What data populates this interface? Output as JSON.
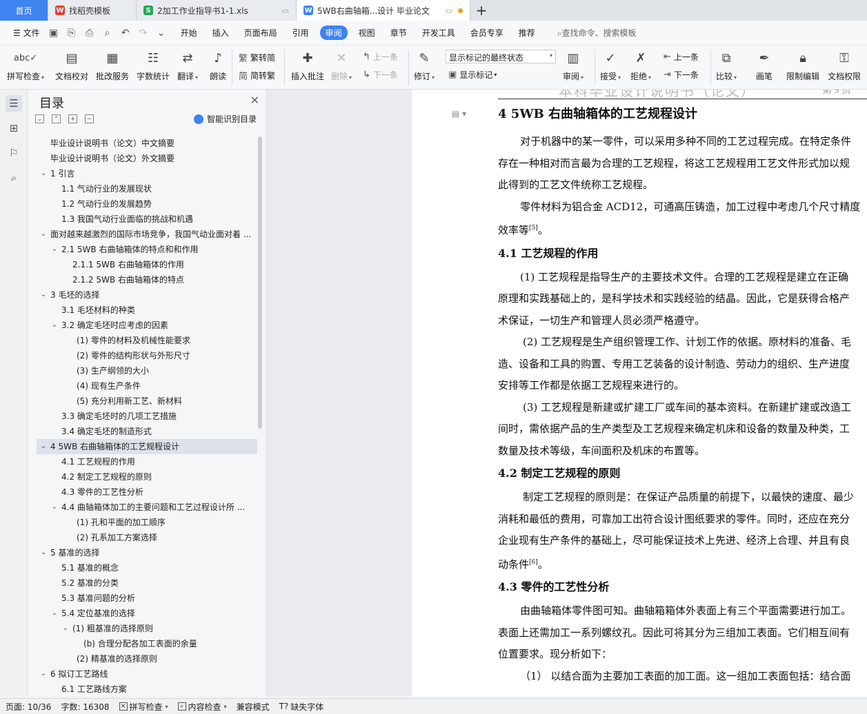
{
  "tabs": [
    {
      "label": "首页",
      "kind": "home"
    },
    {
      "label": "找稻壳模板",
      "kind": "docer",
      "color": "#e0403a",
      "icon": "docer-icon"
    },
    {
      "label": "2加工作业指导书1-1.xls",
      "kind": "xls",
      "color": "#2aa35a",
      "icon": "spreadsheet-icon"
    },
    {
      "label": "5WB右曲轴箱...设计 毕业论文",
      "kind": "doc",
      "color": "#3f83f1",
      "icon": "document-icon"
    }
  ],
  "menu": {
    "file": "文件",
    "items": [
      "开始",
      "插入",
      "页面布局",
      "引用",
      "审阅",
      "视图",
      "章节",
      "开发工具",
      "会员专享",
      "推荐"
    ],
    "active": "审阅",
    "search": "查找命令、搜索模板"
  },
  "ribbon": {
    "spellcheck": "拼写检查",
    "doc_proof": "文档校对",
    "batch_service": "批改服务",
    "word_count": "字数统计",
    "translate": "翻译",
    "read_aloud": "朗读",
    "trad_to_simp": "繁转简",
    "simp_to_trad": "简转繁",
    "insert_comment": "插入批注",
    "delete": "删除",
    "prev_comment": "上一条",
    "next_comment": "下一条",
    "revise": "修订",
    "markup_mode": "显示标记的最终状态",
    "show_markup": "显示标记",
    "review": "审阅",
    "accept": "接受",
    "reject": "拒绝",
    "prev_change": "上一条",
    "next_change": "下一条",
    "compare": "比较",
    "pen": "画笔",
    "restrict_edit": "限制编辑",
    "doc_permission": "文档权限"
  },
  "toc": {
    "title": "目录",
    "smart": "智能识别目录",
    "items": [
      {
        "text": "毕业设计说明书（论文）中文摘要",
        "level": 0,
        "caret": ""
      },
      {
        "text": "毕业设计说明书（论文）外文摘要",
        "level": 0,
        "caret": ""
      },
      {
        "text": "1   引言",
        "level": 0,
        "caret": "v"
      },
      {
        "text": "1.1    气动行业的发展现状",
        "level": 1,
        "caret": ""
      },
      {
        "text": "1.2    气动行业的发展趋势",
        "level": 1,
        "caret": ""
      },
      {
        "text": "1.3    我国气动行业面临的挑战和机遇",
        "level": 1,
        "caret": ""
      },
      {
        "text": "面对越来越激烈的国际市场竞争，我国气动业面对着 ...",
        "level": 0,
        "caret": "v"
      },
      {
        "text": "2.1    5WB 右曲轴箱体的特点和和作用",
        "level": 1,
        "caret": "v"
      },
      {
        "text": "2.1.1    5WB 右曲轴箱体的作用",
        "level": 2,
        "caret": ""
      },
      {
        "text": "2.1.2    5WB 右曲轴箱体的特点",
        "level": 2,
        "caret": ""
      },
      {
        "text": "3   毛坯的选择",
        "level": 0,
        "caret": "v"
      },
      {
        "text": "3.1    毛坯材料的种类",
        "level": 1,
        "caret": ""
      },
      {
        "text": "3.2    确定毛坯时应考虑的因素",
        "level": 1,
        "caret": "v"
      },
      {
        "text": "(1)    零件的材料及机械性能要求",
        "level": 3,
        "caret": ""
      },
      {
        "text": "(2)    零件的结构形状与外形尺寸",
        "level": 3,
        "caret": ""
      },
      {
        "text": "(3)    生产纲领的大小",
        "level": 3,
        "caret": ""
      },
      {
        "text": "(4)    现有生产条件",
        "level": 3,
        "caret": ""
      },
      {
        "text": "(5)    充分利用新工艺、新材料",
        "level": 3,
        "caret": ""
      },
      {
        "text": "3.3    确定毛坯时的几项工艺措施",
        "level": 1,
        "caret": ""
      },
      {
        "text": "3.4    确定毛坯的制造形式",
        "level": 1,
        "caret": ""
      },
      {
        "text": "4   5WB 右曲轴箱体的工艺规程设计",
        "level": 0,
        "caret": "v",
        "selected": true
      },
      {
        "text": "4.1    工艺规程的作用",
        "level": 1,
        "caret": ""
      },
      {
        "text": "4.2    制定工艺规程的原则",
        "level": 1,
        "caret": ""
      },
      {
        "text": "4.3    零件的工艺性分析",
        "level": 1,
        "caret": ""
      },
      {
        "text": "4.4    曲轴箱体加工的主要问题和工艺过程设计所 ...",
        "level": 1,
        "caret": "v"
      },
      {
        "text": "(1)    孔和平面的加工顺序",
        "level": 3,
        "caret": ""
      },
      {
        "text": "(2)    孔系加工方案选择",
        "level": 3,
        "caret": ""
      },
      {
        "text": "5   基准的选择",
        "level": 0,
        "caret": "v"
      },
      {
        "text": "5.1    基准的概念",
        "level": 1,
        "caret": ""
      },
      {
        "text": "5.2    基准的分类",
        "level": 1,
        "caret": ""
      },
      {
        "text": "5.3    基准问题的分析",
        "level": 1,
        "caret": ""
      },
      {
        "text": "5.4    定位基准的选择",
        "level": 1,
        "caret": "v"
      },
      {
        "text": "(1)  粗基准的选择原则",
        "level": 2,
        "caret": "v"
      },
      {
        "text": "(b)  合理分配各加工表面的余量",
        "level": 4,
        "caret": ""
      },
      {
        "text": "(2)    精基准的选择原则",
        "level": 3,
        "caret": ""
      },
      {
        "text": "6   拟订工艺路线",
        "level": 0,
        "caret": "v"
      },
      {
        "text": "6.1    工艺路线方案",
        "level": 1,
        "caret": ""
      }
    ]
  },
  "page": {
    "header": "本科毕业设计说明书（论文）",
    "page_label": "第 9 页",
    "blocks": [
      {
        "type": "h1",
        "text": "4    5WB 右曲轴箱体的工艺规程设计"
      },
      {
        "type": "p",
        "ind": true,
        "text": "对于机器中的某一零件，可以采用多种不同的工艺过程完成。在特定条件"
      },
      {
        "type": "p",
        "text": "存在一种相对而言最为合理的工艺规程，将这工艺规程用工艺文件形式加以规"
      },
      {
        "type": "p",
        "text": "此得到的工艺文件统称工艺规程。"
      },
      {
        "type": "p",
        "ind": true,
        "text": "零件材料为铝合金 ACD12，可通高压铸造，加工过程中考虑几个尺寸精度"
      },
      {
        "type": "p",
        "text": "效率等[5]。"
      },
      {
        "type": "h2",
        "text": "4.1    工艺规程的作用"
      },
      {
        "type": "p",
        "ind": true,
        "text": "(1)  工艺规程是指导生产的主要技术文件。合理的工艺规程是建立在正确"
      },
      {
        "type": "p",
        "text": "原理和实践基础上的，是科学技术和实践经验的结晶。因此，它是获得合格产"
      },
      {
        "type": "p",
        "text": "术保证，一切生产和管理人员必须严格遵守。"
      },
      {
        "type": "p",
        "ind2": true,
        "text": "(2)  工艺规程是生产组织管理工作、计划工作的依据。原材料的准备、毛"
      },
      {
        "type": "p",
        "text": "造、设备和工具的购置、专用工艺装备的设计制造、劳动力的组织、生产进度"
      },
      {
        "type": "p",
        "text": "安排等工作都是依据工艺规程来进行的。"
      },
      {
        "type": "p",
        "ind2": true,
        "text": "(3)  工艺规程是新建或扩建工厂或车间的基本资料。在新建扩建或改造工"
      },
      {
        "type": "p",
        "text": "间时，需依据产品的生产类型及工艺规程来确定机床和设备的数量及种类，工"
      },
      {
        "type": "p",
        "text": "数量及技术等级，车间面积及机床的布置等。"
      },
      {
        "type": "h2",
        "text": "4.2    制定工艺规程的原则"
      },
      {
        "type": "p",
        "ind2": true,
        "text": "制定工艺规程的原则是：在保证产品质量的前提下，以最快的速度、最少"
      },
      {
        "type": "p",
        "text": "消耗和最低的费用，可靠加工出符合设计图纸要求的零件。同时，还应在充分"
      },
      {
        "type": "p",
        "text": "企业现有生产条件的基础上，尽可能保证技术上先进、经济上合理、并且有良"
      },
      {
        "type": "p",
        "text": "动条件[6]。"
      },
      {
        "type": "h2",
        "text": "4.3    零件的工艺性分析"
      },
      {
        "type": "p",
        "ind": true,
        "text": "由曲轴箱体零件图可知。曲轴箱箱体外表面上有三个平面需要进行加工。"
      },
      {
        "type": "p",
        "text": "表面上还需加工一系列螺纹孔。因此可将其分为三组加工表面。它们相互间有"
      },
      {
        "type": "p",
        "text": "位置要求。现分析如下："
      },
      {
        "type": "p",
        "ind": true,
        "text": "（1）  以结合面为主要加工表面的加工面。这一组加工表面包括：结合面"
      }
    ]
  },
  "status": {
    "page": "页面: 10/36",
    "words": "字数: 16308",
    "spell": "拼写检查",
    "content_check": "内容检查",
    "compat": "兼容模式",
    "missing_font": "缺失字体"
  }
}
